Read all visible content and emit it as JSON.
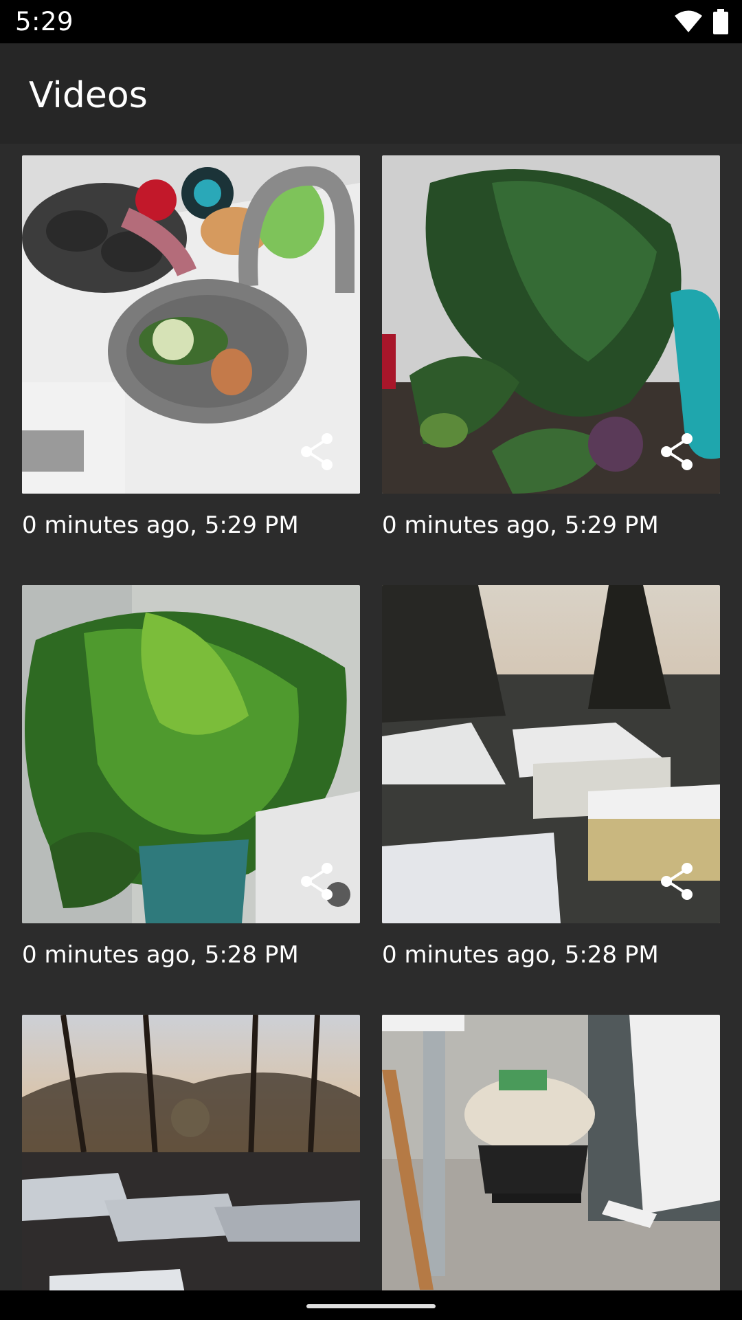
{
  "status_bar": {
    "time": "5:29"
  },
  "app_bar": {
    "title": "Videos"
  },
  "videos": [
    {
      "caption": "0 minutes ago, 5:29 PM",
      "scene": "toy-kitchen-sink"
    },
    {
      "caption": "0 minutes ago, 5:29 PM",
      "scene": "monstera-plant"
    },
    {
      "caption": "0 minutes ago, 5:28 PM",
      "scene": "palm-plant"
    },
    {
      "caption": "0 minutes ago, 5:28 PM",
      "scene": "snowy-houses"
    },
    {
      "caption": "",
      "scene": "sunset-trees"
    },
    {
      "caption": "",
      "scene": "footstool-room"
    }
  ],
  "colors": {
    "background": "#2c2c2c",
    "app_bar": "#262626",
    "text": "#ffffff"
  }
}
